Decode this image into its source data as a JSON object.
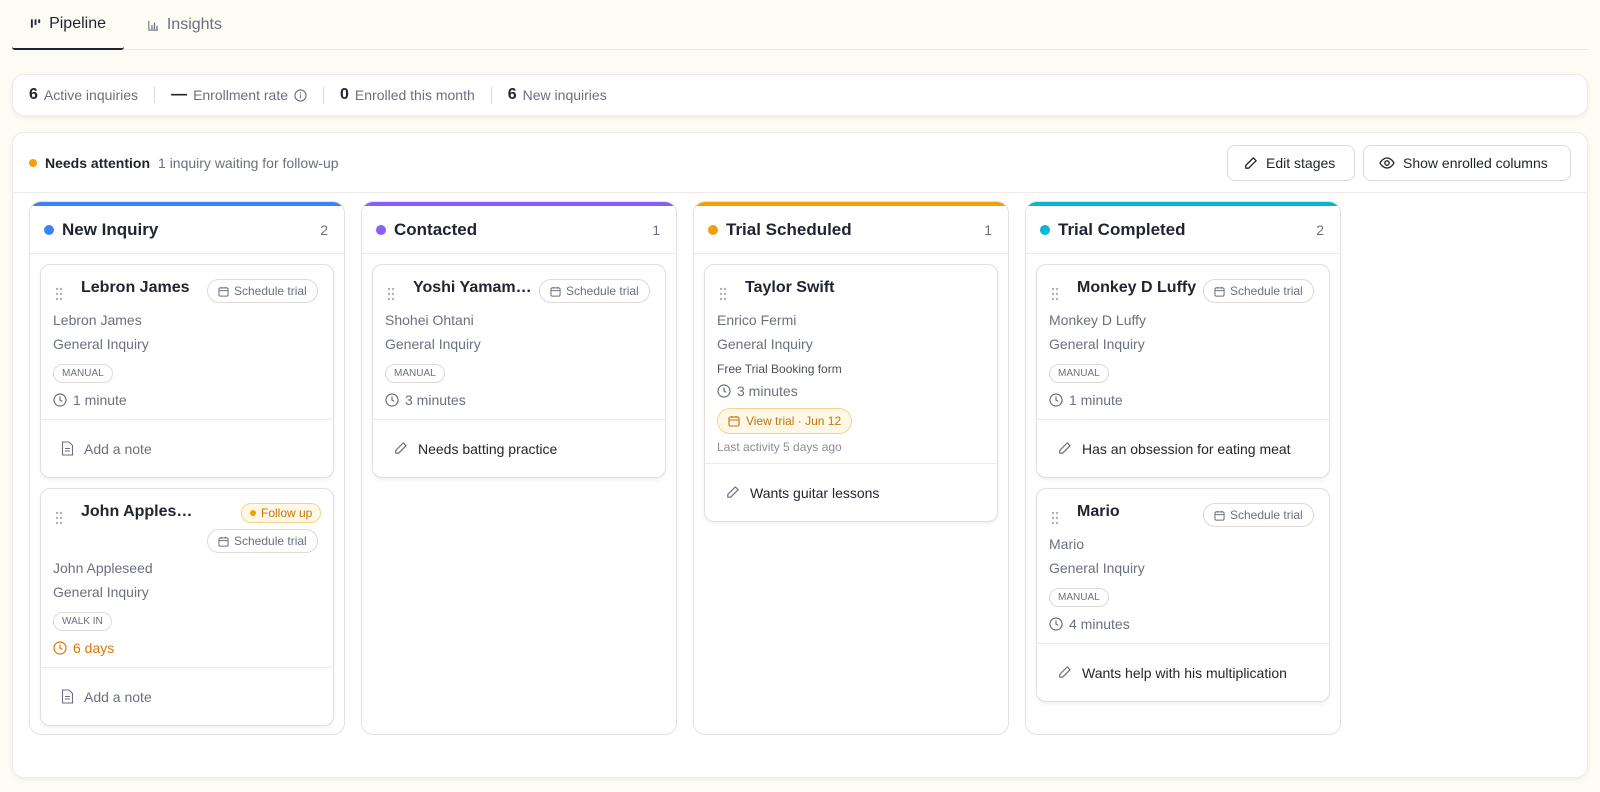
{
  "tabs": [
    {
      "label": "Pipeline",
      "icon": "pipeline-icon",
      "active": true
    },
    {
      "label": "Insights",
      "icon": "bar-chart-icon",
      "active": false
    }
  ],
  "stats": [
    {
      "value": "6",
      "label": "Active inquiries"
    },
    {
      "value": "—",
      "label": "Enrollment rate",
      "info_icon": "info-icon"
    },
    {
      "value": "0",
      "label": "Enrolled this month"
    },
    {
      "value": "6",
      "label": "New inquiries"
    }
  ],
  "attention": {
    "title": "Needs attention",
    "subtitle": "1 inquiry waiting for follow-up",
    "color": "#f59e0b"
  },
  "buttons": {
    "edit_stages": "Edit stages",
    "show_enrolled": "Show enrolled columns"
  },
  "columns": [
    {
      "name": "New Inquiry",
      "count": "2",
      "color": "#3b82f6",
      "cards": [
        {
          "name": "Lebron James",
          "action": "Schedule trial",
          "contact": "Lebron James",
          "type": "General Inquiry",
          "source": "MANUAL",
          "time": "1 minute",
          "note": "Add a note"
        },
        {
          "name": "John Appleseed",
          "follow": "Follow up",
          "action": "Schedule trial",
          "contact": "John Appleseed",
          "type": "General Inquiry",
          "source": "WALK IN",
          "time": "6 days",
          "note": "Add a note"
        }
      ]
    },
    {
      "name": "Contacted",
      "count": "1",
      "color": "#8b5cf6",
      "cards": [
        {
          "name": "Yoshi Yamamoto",
          "action": "Schedule trial",
          "contact": "Shohei Ohtani",
          "type": "General Inquiry",
          "source": "MANUAL",
          "time": "3 minutes",
          "note": "Needs batting practice"
        }
      ]
    },
    {
      "name": "Trial Scheduled",
      "count": "1",
      "color": "#f59e0b",
      "cards": [
        {
          "name": "Taylor Swift",
          "contact": "Enrico Fermi",
          "type": "General Inquiry",
          "form": "Free Trial Booking form",
          "time": "3 minutes",
          "trial": "View trial · Jun 12",
          "last_activity": "Last activity 5 days ago",
          "note": "Wants guitar lessons"
        }
      ]
    },
    {
      "name": "Trial Completed",
      "count": "2",
      "color": "#06b6d4",
      "cards": [
        {
          "name": "Monkey D Luffy",
          "action": "Schedule trial",
          "contact": "Monkey D Luffy",
          "type": "General Inquiry",
          "source": "MANUAL",
          "time": "1 minute",
          "note": "Has an obsession for eating meat"
        },
        {
          "name": "Mario",
          "action": "Schedule trial",
          "contact": "Mario",
          "type": "General Inquiry",
          "source": "MANUAL",
          "time": "4 minutes",
          "note": "Wants help with his multiplication"
        }
      ]
    }
  ]
}
